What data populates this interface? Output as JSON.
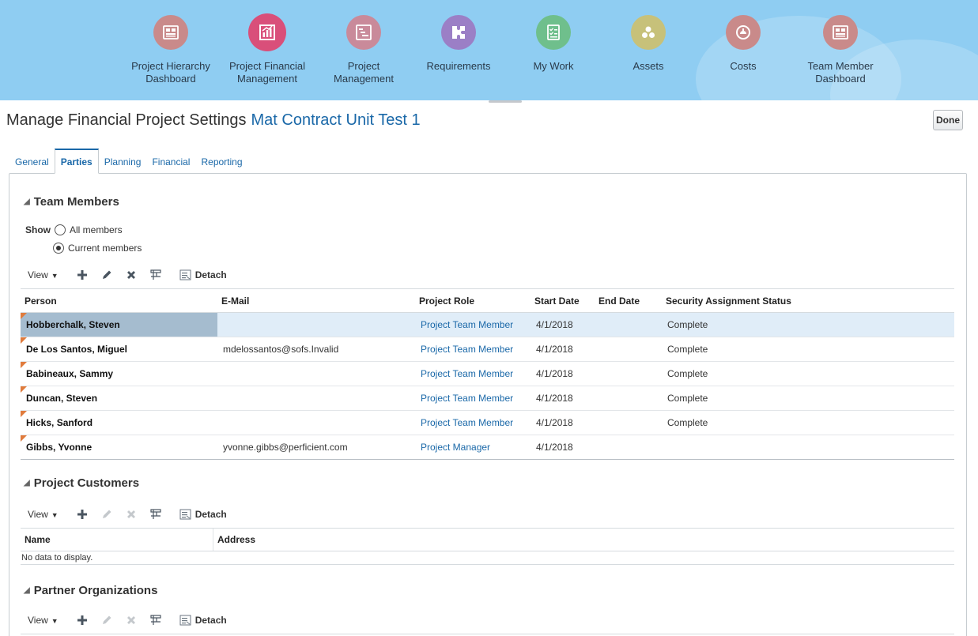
{
  "springboard": {
    "items": [
      {
        "label_line1": "Project Hierarchy",
        "label_line2": "Dashboard",
        "color": "#c98a8a",
        "icon": "dashboard-icon"
      },
      {
        "label_line1": "Project Financial",
        "label_line2": "Management",
        "color": "#d94f7a",
        "icon": "bar-chart-icon"
      },
      {
        "label_line1": "Project",
        "label_line2": "Management",
        "color": "#c98a9a",
        "icon": "gantt-icon"
      },
      {
        "label_line1": "Requirements",
        "label_line2": "",
        "color": "#9b7fc6",
        "icon": "puzzle-icon"
      },
      {
        "label_line1": "My Work",
        "label_line2": "",
        "color": "#6fbf8c",
        "icon": "checklist-icon"
      },
      {
        "label_line1": "Assets",
        "label_line2": "",
        "color": "#c7c17a",
        "icon": "assets-icon"
      },
      {
        "label_line1": "Costs",
        "label_line2": "",
        "color": "#c98a8a",
        "icon": "piggy-bank-icon"
      },
      {
        "label_line1": "Team Member",
        "label_line2": "Dashboard",
        "color": "#c98a8a",
        "icon": "dashboard-icon"
      }
    ]
  },
  "header": {
    "title": "Manage Financial Project Settings",
    "project_name": "Mat Contract Unit Test 1",
    "done_label": "Done"
  },
  "tabs": [
    {
      "label": "General",
      "active": false
    },
    {
      "label": "Parties",
      "active": true
    },
    {
      "label": "Planning",
      "active": false
    },
    {
      "label": "Financial",
      "active": false
    },
    {
      "label": "Reporting",
      "active": false
    }
  ],
  "team_members": {
    "title": "Team Members",
    "show_label": "Show",
    "option_all": "All members",
    "option_current": "Current members",
    "selected_option": "Current members",
    "toolbar": {
      "view": "View",
      "detach": "Detach"
    },
    "columns": [
      "Person",
      "E-Mail",
      "Project Role",
      "Start Date",
      "End Date",
      "Security Assignment Status"
    ],
    "rows": [
      {
        "person": "Hobberchalk, Steven",
        "email": "",
        "role": "Project Team Member",
        "start": "4/1/2018",
        "end": "",
        "status": "Complete"
      },
      {
        "person": "De Los Santos, Miguel",
        "email": "mdelossantos@sofs.Invalid",
        "role": "Project Team Member",
        "start": "4/1/2018",
        "end": "",
        "status": "Complete"
      },
      {
        "person": "Babineaux, Sammy",
        "email": "",
        "role": "Project Team Member",
        "start": "4/1/2018",
        "end": "",
        "status": "Complete"
      },
      {
        "person": "Duncan, Steven",
        "email": "",
        "role": "Project Team Member",
        "start": "4/1/2018",
        "end": "",
        "status": "Complete"
      },
      {
        "person": "Hicks, Sanford",
        "email": "",
        "role": "Project Team Member",
        "start": "4/1/2018",
        "end": "",
        "status": "Complete"
      },
      {
        "person": "Gibbs, Yvonne",
        "email": "yvonne.gibbs@perficient.com",
        "role": "Project Manager",
        "start": "4/1/2018",
        "end": "",
        "status": ""
      }
    ]
  },
  "project_customers": {
    "title": "Project Customers",
    "toolbar": {
      "view": "View",
      "detach": "Detach"
    },
    "columns": [
      "Name",
      "Address"
    ],
    "empty_text": "No data to display."
  },
  "partner_organizations": {
    "title": "Partner Organizations",
    "toolbar": {
      "view": "View",
      "detach": "Detach"
    }
  }
}
